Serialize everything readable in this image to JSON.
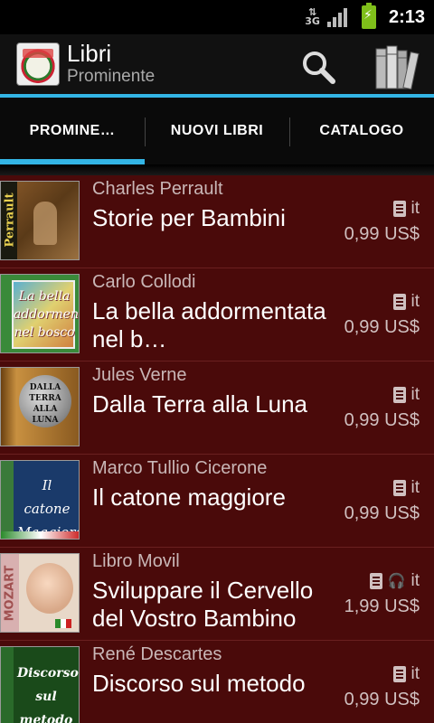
{
  "status_bar": {
    "network": "3G",
    "time": "2:13"
  },
  "header": {
    "title": "Libri",
    "subtitle": "Prominente"
  },
  "tabs": [
    {
      "label": "PROMINE…",
      "active": true
    },
    {
      "label": "NUOVI LIBRI",
      "active": false
    },
    {
      "label": "CATALOGO",
      "active": false
    }
  ],
  "books": [
    {
      "author": "Charles Perrault",
      "title": "Storie per Bambini",
      "lang": "it",
      "price": "0,99 US$",
      "cover_text": "Perrault",
      "audio": false
    },
    {
      "author": "Carlo Collodi",
      "title": "La bella addormentata nel b…",
      "lang": "it",
      "price": "0,99 US$",
      "cover_text": "La bella addormentata nel bosco",
      "audio": false
    },
    {
      "author": "Jules Verne",
      "title": "Dalla Terra alla Luna",
      "lang": "it",
      "price": "0,99 US$",
      "cover_text": "DALLA TERRA ALLA LUNA",
      "audio": false
    },
    {
      "author": "Marco Tullio Cicerone",
      "title": "Il catone maggiore",
      "lang": "it",
      "price": "0,99 US$",
      "cover_text": "Il catone Maggiore",
      "audio": false
    },
    {
      "author": "Libro Movil",
      "title": "Sviluppare il Cervello del Vostro Bambino",
      "lang": "it",
      "price": "1,99 US$",
      "cover_text": "MOZART",
      "audio": true
    },
    {
      "author": "René Descartes",
      "title": "Discorso sul metodo",
      "lang": "it",
      "price": "0,99 US$",
      "cover_text": "Discorso sul metodo",
      "audio": false
    }
  ],
  "colors": {
    "accent": "#33b5e5",
    "row_bg": "#4a0a0a"
  }
}
